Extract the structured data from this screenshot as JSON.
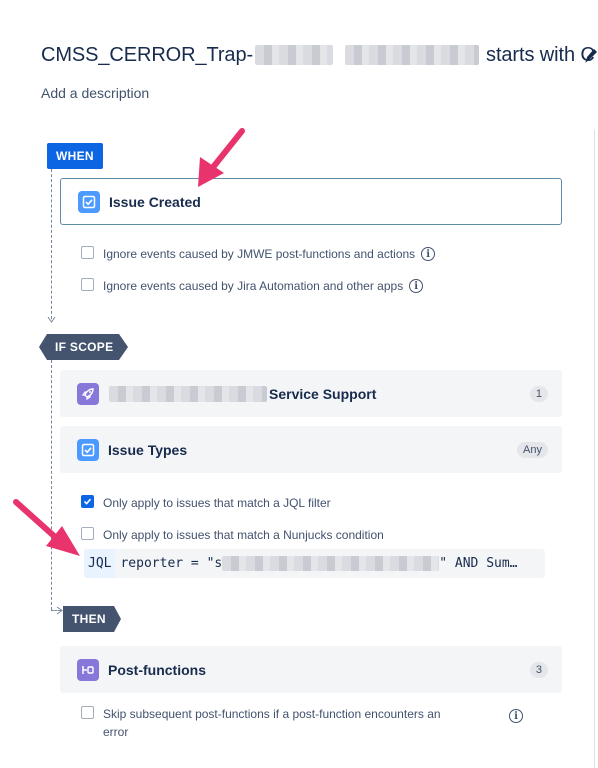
{
  "header": {
    "title_prefix": "CMSS_CERROR_Trap-",
    "title_suffix": "starts with C",
    "description_placeholder": "Add a description"
  },
  "when": {
    "tag": "WHEN",
    "trigger_label": "Issue Created",
    "options": [
      {
        "label": "Ignore events caused by JMWE post-functions and actions",
        "checked": false
      },
      {
        "label": "Ignore events caused by Jira Automation and other apps",
        "checked": false
      }
    ]
  },
  "scope": {
    "tag": "IF SCOPE",
    "project_label": "Service Support",
    "project_count": "1",
    "issue_types_label": "Issue Types",
    "issue_types_badge": "Any",
    "options": [
      {
        "label": "Only apply to issues that match a JQL filter",
        "checked": true
      },
      {
        "label": "Only apply to issues that match a Nunjucks condition",
        "checked": false
      }
    ],
    "jql_key": "JQL",
    "jql_prefix": "reporter = \"s",
    "jql_suffix": "\" AND Sum…"
  },
  "then": {
    "tag": "THEN",
    "postfunctions_label": "Post-functions",
    "postfunctions_count": "3",
    "option_line1": "Skip subsequent post-functions if a post-function encounters an",
    "option_line2": "error"
  },
  "colors": {
    "when_tag": "#0c66e4",
    "hex_tag": "#44546f",
    "annotation_arrow": "#e8336d",
    "checkbox_checked": "#0c66e4"
  }
}
